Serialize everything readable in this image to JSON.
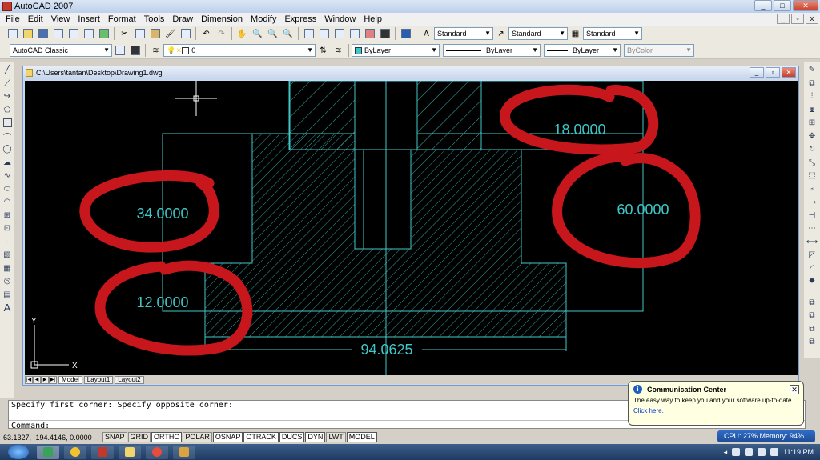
{
  "window": {
    "title": "AutoCAD 2007"
  },
  "menu": [
    "File",
    "Edit",
    "View",
    "Insert",
    "Format",
    "Tools",
    "Draw",
    "Dimension",
    "Modify",
    "Express",
    "Window",
    "Help"
  ],
  "toolbar": {
    "text_style": "Standard",
    "dim_style": "Standard",
    "table_style": "Standard",
    "workspace": "AutoCAD Classic",
    "layer": "0",
    "color": "ByLayer",
    "linetype": "ByLayer",
    "lineweight": "ByLayer",
    "plotstyle": "ByColor"
  },
  "drawing": {
    "title": "C:\\Users\\tantan\\Desktop\\Drawing1.dwg",
    "dimensions": {
      "d_top": "18.0000",
      "d_right": "60.0000",
      "d_left": "34.0000",
      "d_left_bottom": "12.0000",
      "d_bottom": "94.0625"
    },
    "ucs": {
      "x": "X",
      "y": "Y"
    },
    "tabs": [
      "Model",
      "Layout1",
      "Layout2"
    ]
  },
  "command": {
    "history": "Specify first corner: Specify opposite corner:",
    "prompt": "Command:"
  },
  "status": {
    "coords": "63.1327, -194.4146, 0.0000",
    "toggles": [
      "SNAP",
      "GRID",
      "ORTHO",
      "POLAR",
      "OSNAP",
      "OTRACK",
      "DUCS",
      "DYN",
      "LWT",
      "MODEL"
    ]
  },
  "balloon": {
    "title": "Communication Center",
    "message": "The easy way to keep you and your software up-to-date.",
    "link": "Click here."
  },
  "perf": {
    "text": "CPU: 27%   Memory: 94%"
  },
  "clock": "11:19 PM",
  "colors": {
    "drawing_line": "#3fc7c7",
    "annotation": "#c8161d",
    "canvas": "#000000"
  }
}
